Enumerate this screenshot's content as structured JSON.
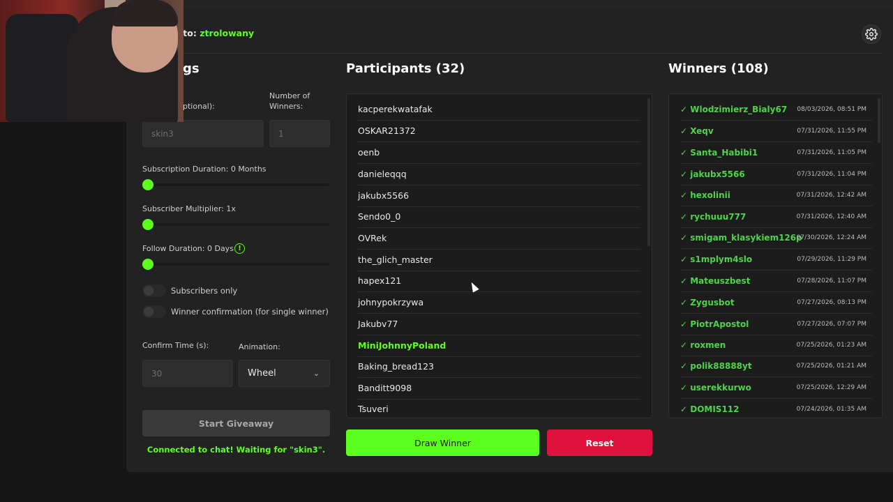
{
  "header": {
    "connected_prefix": "d to: ",
    "connected_user": "ztrolowany"
  },
  "settings": {
    "title_fragment": "gs",
    "keyword_label_fragment": "ptional):",
    "keyword_value": "skin3",
    "num_winners_label": "Number of Winners:",
    "num_winners_value": "1",
    "sub_duration_label": "Subscription Duration: 0 Months",
    "sub_duration_level": 0,
    "sub_multiplier_label": "Subscriber Multiplier: 1x",
    "sub_multiplier_level": 0,
    "follow_duration_label": "Follow Duration:  0  Days",
    "follow_duration_level": 0,
    "subscribers_only_label": "Subscribers only",
    "subscribers_only_on": false,
    "winner_confirmation_label": "Winner confirmation (for single winner)",
    "winner_confirmation_on": false,
    "confirm_time_label": "Confirm Time (s):",
    "confirm_time_value": "30",
    "animation_label": "Animation:",
    "animation_value": "Wheel",
    "start_label": "Start Giveaway",
    "status_text": "Connected to chat! Waiting for \"skin3\"."
  },
  "participants": {
    "title": "Participants (32)",
    "items": [
      {
        "name": "kacperekwatafak",
        "highlight": false
      },
      {
        "name": "OSKAR21372",
        "highlight": false
      },
      {
        "name": "oenb",
        "highlight": false
      },
      {
        "name": "danieleqqq",
        "highlight": false
      },
      {
        "name": "jakubx5566",
        "highlight": false
      },
      {
        "name": "Sendo0_0",
        "highlight": false
      },
      {
        "name": "OVRek",
        "highlight": false
      },
      {
        "name": "the_glich_master",
        "highlight": false
      },
      {
        "name": "hapex121",
        "highlight": false
      },
      {
        "name": "johnypokrzywa",
        "highlight": false
      },
      {
        "name": "Jakubv77",
        "highlight": false
      },
      {
        "name": "MiniJohnnyPoland",
        "highlight": true
      },
      {
        "name": "Baking_bread123",
        "highlight": false
      },
      {
        "name": "Banditt9098",
        "highlight": false
      },
      {
        "name": "Tsuveri",
        "highlight": false
      }
    ],
    "draw_label": "Draw Winner",
    "reset_label": "Reset"
  },
  "winners": {
    "title": "Winners (108)",
    "items": [
      {
        "name": "✓ Wlodzimierz_Bialy67",
        "time": "08/03/2026, 08:51 PM"
      },
      {
        "name": "✓ Xeqv",
        "time": "07/31/2026, 11:55 PM"
      },
      {
        "name": "✓ Santa_Habibi1",
        "time": "07/31/2026, 11:05 PM"
      },
      {
        "name": "✓ jakubx5566",
        "time": "07/31/2026, 11:04 PM"
      },
      {
        "name": "✓ hexolinii",
        "time": "07/31/2026, 12:42 AM"
      },
      {
        "name": "✓ rychuuu777",
        "time": "07/31/2026, 12:40 AM"
      },
      {
        "name": "✓ smigam_klasykiem126p",
        "time": "07/30/2026, 12:24 AM"
      },
      {
        "name": "✓ s1mplym4slo",
        "time": "07/29/2026, 11:29 PM"
      },
      {
        "name": "✓ Mateuszbest",
        "time": "07/28/2026, 11:07 PM"
      },
      {
        "name": "✓ Zygusbot",
        "time": "07/27/2026, 08:13 PM"
      },
      {
        "name": "✓ PiotrApostol",
        "time": "07/27/2026, 07:07 PM"
      },
      {
        "name": "✓ roxmen",
        "time": "07/25/2026, 01:23 AM"
      },
      {
        "name": "✓ polik88888yt",
        "time": "07/25/2026, 01:21 AM"
      },
      {
        "name": "✓ userekkurwo",
        "time": "07/25/2026, 12:29 AM"
      },
      {
        "name": "✓ DOMIS112",
        "time": "07/24/2026, 01:35 AM"
      }
    ]
  },
  "colors": {
    "accent": "#5dff1e",
    "danger": "#e0113d",
    "winner_green": "#4ed34a",
    "panel": "#222222",
    "background": "#161616"
  },
  "icons": {
    "settings": "gear-icon",
    "info": "info-icon",
    "dropdown": "chevron-down-icon"
  }
}
